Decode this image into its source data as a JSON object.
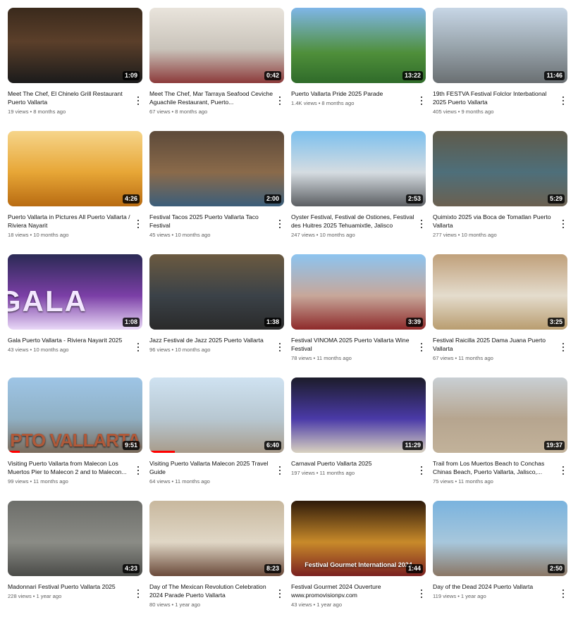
{
  "videos": [
    {
      "title": "Meet The Chef, El Chinelo Grill Restaurant Puerto Vallarta",
      "views": "19 views",
      "age": "8 months ago",
      "duration": "1:09",
      "thumb_icon": "chef-portrait-thumbnail"
    },
    {
      "title": "Meet The Chef, Mar Tarraya Seafood Ceviche Aguachile Restaurant, Puerto...",
      "views": "67 views",
      "age": "8 months ago",
      "duration": "0:42",
      "thumb_icon": "chef-portrait-thumbnail"
    },
    {
      "title": "Puerto Vallarta Pride 2025 Parade",
      "views": "1.4K views",
      "age": "8 months ago",
      "duration": "13:22",
      "thumb_icon": "parade-float-thumbnail"
    },
    {
      "title": "19th FESTVA Festival Folclor Interbational 2025 Puerto Vallarta",
      "views": "405 views",
      "age": "9 months ago",
      "duration": "11:46",
      "thumb_icon": "folk-dancers-thumbnail"
    },
    {
      "title": "Puerto Vallarta in Pictures All Puerto Vallarta / Riviera Nayarit",
      "views": "18 views",
      "age": "10 months ago",
      "duration": "4:26",
      "thumb_icon": "sunset-couple-thumbnail"
    },
    {
      "title": "Festival Tacos 2025 Puerto Vallarta Taco Festival",
      "views": "45 views",
      "age": "10 months ago",
      "duration": "2:00",
      "thumb_icon": "taco-stand-thumbnail"
    },
    {
      "title": "Oyster Festival, Festival de Ostiones, Festival des Huitres 2025 Tehuamixtle, Jalisco",
      "views": "247 views",
      "age": "10 months ago",
      "duration": "2:53",
      "thumb_icon": "festival-crowd-thumbnail"
    },
    {
      "title": "Quimixto 2025 via Boca de Tomatlan Puerto Vallarta",
      "views": "277 views",
      "age": "10 months ago",
      "duration": "5:29",
      "thumb_icon": "waterfall-thumbnail"
    },
    {
      "title": "Gala Puerto Vallarta - Riviera Nayarit 2025",
      "views": "43 views",
      "age": "10 months ago",
      "duration": "1:08",
      "thumb_icon": "gala-sign-thumbnail",
      "overlay": "GALA"
    },
    {
      "title": "Jazz Festival de Jazz 2025 Puerto Vallarta",
      "views": "96 views",
      "age": "10 months ago",
      "duration": "1:38",
      "thumb_icon": "jazz-band-thumbnail"
    },
    {
      "title": "Festival VINOMA 2025 Puerto Vallarta Wine Festival",
      "views": "78 views",
      "age": "11 months ago",
      "duration": "3:39",
      "thumb_icon": "wine-festival-thumbnail"
    },
    {
      "title": "Festival Raicilla 2025 Dama Juana Puerto Vallarta",
      "views": "67 views",
      "age": "11 months ago",
      "duration": "3:25",
      "thumb_icon": "raicilla-bottles-thumbnail"
    },
    {
      "title": "Visiting Puerto Vallarta from Malecon Los Muertos Pier to Malecon 2 and to Malecon...",
      "views": "99 views",
      "age": "11 months ago",
      "duration": "9:51",
      "thumb_icon": "malecon-sign-thumbnail",
      "overlay": "PTO VALLARTA"
    },
    {
      "title": "Visiting Puerto Vallarta Malecon 2025 Travel Guide",
      "views": "64 views",
      "age": "11 months ago",
      "duration": "6:40",
      "thumb_icon": "malecon-sculpture-thumbnail"
    },
    {
      "title": "Carnaval Puerto Vallarta 2025",
      "views": "197 views",
      "age": "11 months ago",
      "duration": "11:29",
      "thumb_icon": "carnaval-costume-thumbnail"
    },
    {
      "title": "Trail from Los Muertos Beach to Conchas Chinas Beach, Puerto Vallarta, Jalisco,...",
      "views": "75 views",
      "age": "11 months ago",
      "duration": "19:37",
      "thumb_icon": "beach-trail-thumbnail"
    },
    {
      "title": "Madonnari Festival Puerto Vallarta 2025",
      "views": "228 views",
      "age": "1 year ago",
      "duration": "4:23",
      "thumb_icon": "street-chalk-art-thumbnail"
    },
    {
      "title": "Day of The Mexican Revolution Celebration 2024 Parade Puerto Vallarta",
      "views": "80 views",
      "age": "1 year ago",
      "duration": "8:23",
      "thumb_icon": "revolution-parade-thumbnail"
    },
    {
      "title": "Festival Gourmet 2024 Ouverture www.promovisionpv.com",
      "views": "43 views",
      "age": "1 year ago",
      "duration": "1:44",
      "thumb_icon": "gourmet-lights-thumbnail",
      "overlay": "Festival Gourmet International 2024"
    },
    {
      "title": "Day of the Dead 2024 Puerto Vallarta",
      "views": "119 views",
      "age": "1 year ago",
      "duration": "2:50",
      "thumb_icon": "malecon-selfie-thumbnail"
    }
  ],
  "watched_progress": {
    "12": 0.09,
    "13": 0.19
  },
  "meta_separator": "•",
  "colors": {
    "duration_badge_bg": "#000000cc",
    "progress": "#ff0000",
    "meta_text": "#606060",
    "title_text": "#0f0f0f"
  }
}
